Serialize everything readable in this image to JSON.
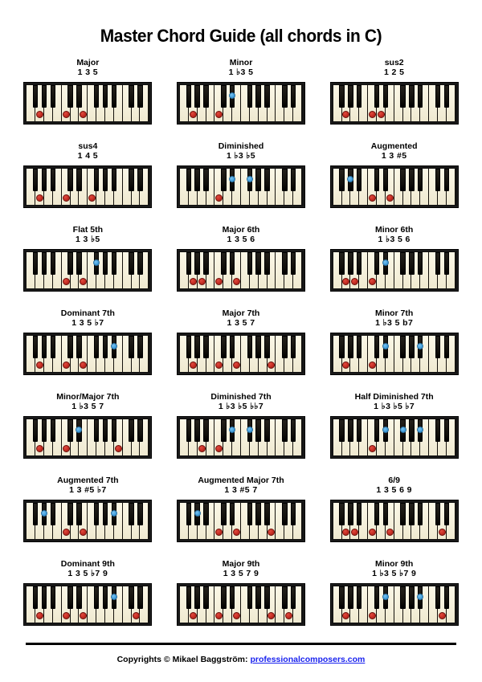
{
  "title": "Master Chord Guide (all chords in C)",
  "keyboard": {
    "white_key_count": 14,
    "start_note": "F",
    "white_notes": [
      "F",
      "G",
      "A",
      "B",
      "C",
      "D",
      "E",
      "F",
      "G",
      "A",
      "B",
      "C",
      "D",
      "E"
    ],
    "black_notes": [
      "F#",
      "G#",
      "A#",
      "C#",
      "D#",
      "F#",
      "G#",
      "A#",
      "C#",
      "D#"
    ],
    "marker_colors": {
      "white_key_dot": "#c42b22",
      "black_key_dot": "#47a3e0"
    },
    "white_key_color": "#f7f2e0",
    "black_key_color": "#100e0a",
    "case_color": "#141414"
  },
  "chords": [
    {
      "name": "Major",
      "formula": "1 3 5",
      "notes": [
        "C",
        "E",
        "G"
      ]
    },
    {
      "name": "Minor",
      "formula": "1 ♭3 5",
      "notes": [
        "C",
        "D#",
        "G"
      ]
    },
    {
      "name": "sus2",
      "formula": "1 2 5",
      "notes": [
        "C",
        "D",
        "G"
      ]
    },
    {
      "name": "sus4",
      "formula": "1 4 5",
      "notes": [
        "C",
        "F2",
        "G"
      ]
    },
    {
      "name": "Diminished",
      "formula": "1 ♭3 ♭5",
      "notes": [
        "C",
        "D#",
        "F#2"
      ]
    },
    {
      "name": "Augmented",
      "formula": "1 3 #5",
      "notes": [
        "C",
        "E",
        "G#"
      ]
    },
    {
      "name": "Flat 5th",
      "formula": "1 3 ♭5",
      "notes": [
        "C",
        "E",
        "F#2"
      ]
    },
    {
      "name": "Major 6th",
      "formula": "1 3 5 6",
      "notes": [
        "C",
        "E",
        "G",
        "A"
      ]
    },
    {
      "name": "Minor 6th",
      "formula": "1 ♭3 5 6",
      "notes": [
        "C",
        "D#",
        "G",
        "A"
      ]
    },
    {
      "name": "Dominant 7th",
      "formula": "1 3 5 ♭7",
      "notes": [
        "C",
        "E",
        "G",
        "A#2"
      ]
    },
    {
      "name": "Major 7th",
      "formula": "1 3 5 7",
      "notes": [
        "C",
        "E",
        "G",
        "B2"
      ]
    },
    {
      "name": "Minor 7th",
      "formula": "1 ♭3 5 b7",
      "notes": [
        "C",
        "D#",
        "G",
        "A#2"
      ]
    },
    {
      "name": "Minor/Major 7th",
      "formula": "1 ♭3 5 7",
      "notes": [
        "C",
        "D#",
        "G",
        "B2"
      ]
    },
    {
      "name": "Diminished 7th",
      "formula": "1 ♭3 ♭5 ♭♭7",
      "notes": [
        "C",
        "D#",
        "F#2",
        "A"
      ]
    },
    {
      "name": "Half Diminished 7th",
      "formula": "1 ♭3 ♭5 ♭7",
      "notes": [
        "C",
        "D#",
        "F#2",
        "A#2"
      ]
    },
    {
      "name": "Augmented 7th",
      "formula": "1 3 #5 ♭7",
      "notes": [
        "C",
        "E",
        "G#",
        "A#2"
      ]
    },
    {
      "name": "Augmented Major 7th",
      "formula": "1 3 #5 7",
      "notes": [
        "C",
        "E",
        "G#",
        "B2"
      ]
    },
    {
      "name": "6/9",
      "formula": "1 3 5 6 9",
      "notes": [
        "C",
        "E",
        "G",
        "A",
        "D2"
      ]
    },
    {
      "name": "Dominant 9th",
      "formula": "1 3 5 ♭7 9",
      "notes": [
        "C",
        "E",
        "G",
        "A#2",
        "D2"
      ]
    },
    {
      "name": "Major 9th",
      "formula": "1 3 5 7 9",
      "notes": [
        "C",
        "E",
        "G",
        "B2",
        "D2"
      ]
    },
    {
      "name": "Minor 9th",
      "formula": "1 ♭3 5 ♭7 9",
      "notes": [
        "C",
        "D#",
        "G",
        "A#2",
        "D2"
      ]
    }
  ],
  "footer": {
    "text": "Copyrights © Mikael Baggström: ",
    "link": "professionalcomposers.com",
    "link_color": "#1a23ef"
  }
}
